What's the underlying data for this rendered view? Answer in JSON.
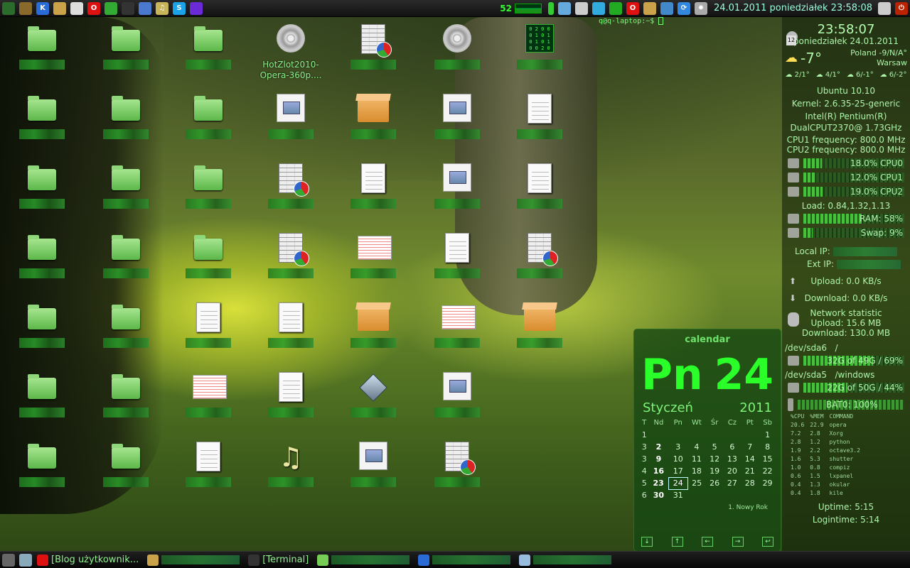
{
  "topbar": {
    "launchers": [
      {
        "name": "terminal-launcher-icon",
        "color": "#2b6b2b",
        "glyph": ""
      },
      {
        "name": "file-manager-icon",
        "color": "#8a6a2a",
        "glyph": ""
      },
      {
        "name": "kde-icon",
        "color": "#2a6bd6",
        "glyph": "K"
      },
      {
        "name": "gimp-icon",
        "color": "#c9a24a",
        "glyph": ""
      },
      {
        "name": "text-editor-icon",
        "color": "#ddd",
        "glyph": ""
      },
      {
        "name": "opera-icon",
        "color": "#d11",
        "glyph": "O"
      },
      {
        "name": "recycle-icon",
        "color": "#3a3",
        "glyph": ""
      },
      {
        "name": "console-icon",
        "color": "#333",
        "glyph": ""
      },
      {
        "name": "globe-icon",
        "color": "#4a7ad0",
        "glyph": ""
      },
      {
        "name": "music-icon",
        "color": "#c8b45a",
        "glyph": "♫"
      },
      {
        "name": "skype-icon",
        "color": "#1aa3e8",
        "glyph": "S"
      },
      {
        "name": "wizard-hat-icon",
        "color": "#6a2bd6",
        "glyph": ""
      }
    ],
    "cpu_graph_value": "52",
    "datetime": "24.01.2011 poniedziałek 23:58:08"
  },
  "terminal_prompt": "q@q-laptop:~$",
  "icons": [
    {
      "col": 0,
      "row": 0,
      "type": "folder",
      "label": ""
    },
    {
      "col": 1,
      "row": 0,
      "type": "folder",
      "label": ""
    },
    {
      "col": 2,
      "row": 0,
      "type": "folder",
      "label": ""
    },
    {
      "col": 3,
      "row": 0,
      "type": "film",
      "label": "HotZlot2010-Opera-360p...."
    },
    {
      "col": 4,
      "row": 0,
      "type": "sheet",
      "label": ""
    },
    {
      "col": 5,
      "row": 0,
      "type": "film",
      "label": ""
    },
    {
      "col": 6,
      "row": 0,
      "type": "matrix",
      "label": ""
    },
    {
      "col": 0,
      "row": 1,
      "type": "folder",
      "label": ""
    },
    {
      "col": 1,
      "row": 1,
      "type": "folder",
      "label": ""
    },
    {
      "col": 2,
      "row": 1,
      "type": "folder",
      "label": ""
    },
    {
      "col": 3,
      "row": 1,
      "type": "img-doc",
      "label": ""
    },
    {
      "col": 4,
      "row": 1,
      "type": "box",
      "label": ""
    },
    {
      "col": 5,
      "row": 1,
      "type": "img-doc",
      "label": ""
    },
    {
      "col": 6,
      "row": 1,
      "type": "doc",
      "label": ""
    },
    {
      "col": 0,
      "row": 2,
      "type": "folder",
      "label": ""
    },
    {
      "col": 1,
      "row": 2,
      "type": "folder",
      "label": ""
    },
    {
      "col": 2,
      "row": 2,
      "type": "folder",
      "label": ""
    },
    {
      "col": 3,
      "row": 2,
      "type": "sheet",
      "label": ""
    },
    {
      "col": 4,
      "row": 2,
      "type": "doc",
      "label": ""
    },
    {
      "col": 5,
      "row": 2,
      "type": "img-doc",
      "label": ""
    },
    {
      "col": 6,
      "row": 2,
      "type": "doc",
      "label": ""
    },
    {
      "col": 0,
      "row": 3,
      "type": "folder",
      "label": ""
    },
    {
      "col": 1,
      "row": 3,
      "type": "folder",
      "label": ""
    },
    {
      "col": 2,
      "row": 3,
      "type": "folder",
      "label": ""
    },
    {
      "col": 3,
      "row": 3,
      "type": "sheet",
      "label": ""
    },
    {
      "col": 4,
      "row": 3,
      "type": "wide",
      "label": ""
    },
    {
      "col": 5,
      "row": 3,
      "type": "doc",
      "label": ""
    },
    {
      "col": 6,
      "row": 3,
      "type": "sheet",
      "label": ""
    },
    {
      "col": 0,
      "row": 4,
      "type": "folder",
      "label": ""
    },
    {
      "col": 1,
      "row": 4,
      "type": "folder",
      "label": ""
    },
    {
      "col": 2,
      "row": 4,
      "type": "doc",
      "label": ""
    },
    {
      "col": 3,
      "row": 4,
      "type": "doc",
      "label": ""
    },
    {
      "col": 4,
      "row": 4,
      "type": "box",
      "label": ""
    },
    {
      "col": 5,
      "row": 4,
      "type": "wide",
      "label": ""
    },
    {
      "col": 6,
      "row": 4,
      "type": "box",
      "label": ""
    },
    {
      "col": 0,
      "row": 5,
      "type": "folder",
      "label": ""
    },
    {
      "col": 1,
      "row": 5,
      "type": "folder",
      "label": ""
    },
    {
      "col": 2,
      "row": 5,
      "type": "wide",
      "label": ""
    },
    {
      "col": 3,
      "row": 5,
      "type": "doc",
      "label": ""
    },
    {
      "col": 4,
      "row": 5,
      "type": "diam",
      "label": ""
    },
    {
      "col": 5,
      "row": 5,
      "type": "img-doc",
      "label": ""
    },
    {
      "col": 0,
      "row": 6,
      "type": "folder",
      "label": ""
    },
    {
      "col": 1,
      "row": 6,
      "type": "folder",
      "label": ""
    },
    {
      "col": 2,
      "row": 6,
      "type": "doc",
      "label": ""
    },
    {
      "col": 3,
      "row": 6,
      "type": "note",
      "label": ""
    },
    {
      "col": 4,
      "row": 6,
      "type": "img-doc",
      "label": ""
    },
    {
      "col": 5,
      "row": 6,
      "type": "sheet",
      "label": ""
    }
  ],
  "conky": {
    "time": "23:58:07",
    "date": "poniedziałek 24.01.2011",
    "temp": "-7°",
    "location": "Poland -9/N/A°",
    "city": "Warsaw",
    "forecast": [
      "2/1°",
      "4/1°",
      "6/-1°",
      "6/-2°"
    ],
    "os": "Ubuntu 10.10",
    "kernel": "Kernel: 2.6.35-25-generic",
    "cpu_model_1": "Intel(R) Pentium(R)",
    "cpu_model_2": "DualCPUT2370@ 1.73GHz",
    "cpu1_freq": "CPU1 frequency: 800.0 MHz",
    "cpu2_freq": "CPU2 frequency: 800.0 MHz",
    "cpu_rows": [
      {
        "label": "18.0% CPU0",
        "fraction": 0.18
      },
      {
        "label": "12.0% CPU1",
        "fraction": 0.12
      },
      {
        "label": "19.0% CPU2",
        "fraction": 0.19
      }
    ],
    "load": "Load: 0.84,1.32,1.13",
    "ram": {
      "label": "RAM: 58%",
      "fraction": 0.58
    },
    "swap": {
      "label": "Swap: 9%",
      "fraction": 0.09
    },
    "local_ip": "Local IP:",
    "ext_ip": "Ext IP:",
    "upload": "Upload: 0.0 KB/s",
    "download": "Download: 0.0 KB/s",
    "net_title": "Network statistic",
    "net_up": "Upload: 15.6 MB",
    "net_down": "Download: 130.0 MB",
    "disk1_label": "/dev/sda6",
    "disk1_mount": "/",
    "disk1": {
      "label": "32G of 49G / 69%",
      "fraction": 0.69
    },
    "disk2_label": "/dev/sda5",
    "disk2_mount": "/windows",
    "disk2": {
      "label": "22G of 50G / 44%",
      "fraction": 0.44
    },
    "battery": {
      "label": "BAT0: 100%",
      "fraction": 1.0
    },
    "proc_header": [
      "%CPU",
      "%MEM",
      "COMMAND"
    ],
    "processes": [
      [
        "20.6",
        "22.9",
        "opera"
      ],
      [
        "7.2",
        "2.8",
        "Xorg"
      ],
      [
        "2.8",
        "1.2",
        "python"
      ],
      [
        "1.9",
        "2.2",
        "octave3.2"
      ],
      [
        "1.6",
        "5.3",
        "shutter"
      ],
      [
        "1.0",
        "0.8",
        "compiz"
      ],
      [
        "0.6",
        "1.5",
        "lxpanel"
      ],
      [
        "0.4",
        "1.3",
        "okular"
      ],
      [
        "0.4",
        "1.8",
        "kile"
      ]
    ],
    "uptime": "Uptime: 5:15",
    "logintime": "Logintime: 5:14"
  },
  "calendar": {
    "title": "calendar",
    "big_day": "Pn",
    "big_num": "24",
    "month": "Styczeń",
    "year": "2011",
    "headers": [
      "T",
      "Nd",
      "Pn",
      "Wt",
      "Śr",
      "Cz",
      "Pt",
      "Sb"
    ],
    "weeks": [
      [
        "1",
        "",
        "",
        "",
        "",
        "",
        "",
        "1"
      ],
      [
        "3",
        "2",
        "3",
        "4",
        "5",
        "6",
        "7",
        "8"
      ],
      [
        "3",
        "9",
        "10",
        "11",
        "12",
        "13",
        "14",
        "15"
      ],
      [
        "4",
        "16",
        "17",
        "18",
        "19",
        "20",
        "21",
        "22"
      ],
      [
        "5",
        "23",
        "24",
        "25",
        "26",
        "27",
        "28",
        "29"
      ],
      [
        "6",
        "30",
        "31",
        "",
        "",
        "",
        "",
        ""
      ]
    ],
    "today": "24",
    "holiday": "1. Nowy Rok",
    "nav": [
      "↓",
      "↑",
      "←",
      "→",
      "↩"
    ]
  },
  "taskbar": {
    "items": [
      {
        "name": "task-opera",
        "label": "[Blog użytkownik...",
        "color": "#d11"
      },
      {
        "name": "task-gimp",
        "label": "",
        "color": "#c9a24a"
      },
      {
        "name": "task-terminal",
        "label": "[Terminal]",
        "color": "#333"
      },
      {
        "name": "task-files",
        "label": "",
        "color": "#7c5"
      },
      {
        "name": "task-kde",
        "label": "",
        "color": "#2a6bd6"
      },
      {
        "name": "task-doc",
        "label": "",
        "color": "#9bd"
      }
    ]
  }
}
